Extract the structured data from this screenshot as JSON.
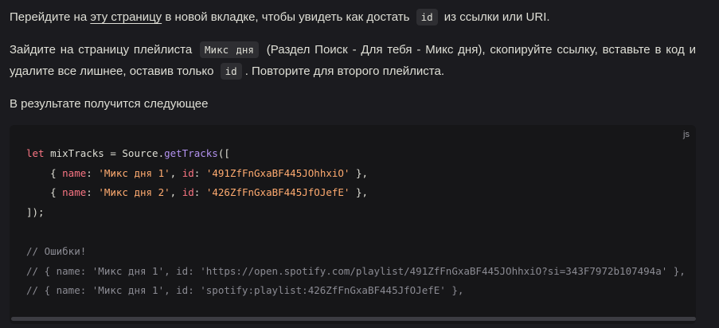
{
  "p1": {
    "before": "Перейдите на ",
    "link": "эту страницу",
    "middle": " в новой вкладке, чтобы увидеть как достать ",
    "code": "id",
    "after": " из ссылки или URI."
  },
  "p2": {
    "before": "Зайдите на страницу плейлиста ",
    "code1": "Микс дня",
    "middle": " (Раздел Поиск - Для тебя - Микс дня), скопируйте ссылку, вставьте в код и удалите все лишнее, оставив только ",
    "code2": "id",
    "after": ". Повторите для второго плейлиста."
  },
  "p3": {
    "text": "В результате получится следующее"
  },
  "code": {
    "lang": "js",
    "l1": {
      "kw": "let",
      "a": " mixTracks = Source.",
      "fn": "getTracks",
      "b": "(["
    },
    "l2": {
      "indent": "    { ",
      "k1": "name",
      "c1": ": ",
      "v1": "'Микс дня 1'",
      "c2": ", ",
      "k2": "id",
      "c3": ": ",
      "v2": "'491ZfFnGxaBF445JOhhxiO'",
      "end": " },"
    },
    "l3": {
      "indent": "    { ",
      "k1": "name",
      "c1": ": ",
      "v1": "'Микс дня 2'",
      "c2": ", ",
      "k2": "id",
      "c3": ": ",
      "v2": "'426ZfFnGxaBF445JfOJefE'",
      "end": " },"
    },
    "l4": "]);",
    "c1": "// Ошибки!",
    "c2": "// { name: 'Микс дня 1', id: 'https://open.spotify.com/playlist/491ZfFnGxaBF445JOhhxiO?si=343F7972b107494a' },",
    "c3": "// { name: 'Микс дня 1', id: 'spotify:playlist:426ZfFnGxaBF445JfOJefE' },"
  }
}
